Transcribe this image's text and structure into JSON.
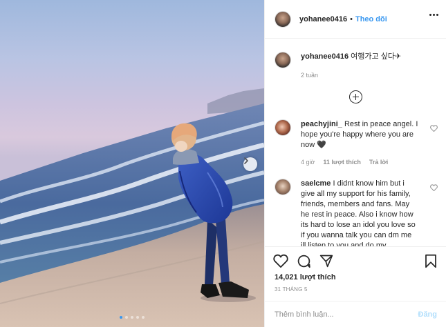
{
  "post": {
    "dots_count": 5,
    "active_dot": 0
  },
  "header": {
    "username": "yohanee0416",
    "separator": "•",
    "follow_label": "Theo dõi",
    "more_icon": "more-horizontal-icon"
  },
  "caption": {
    "username": "yohanee0416",
    "text": "여행가고 싶다✈",
    "time": "2 tuần"
  },
  "load_more_icon": "plus-circle-icon",
  "comments": [
    {
      "username": "peachyjini_",
      "text": "Rest in peace angel. I hope you're happy where you are now 🖤",
      "time": "4 giờ",
      "likes": "11 lượt thích",
      "reply": "Trả lời"
    },
    {
      "username": "saelcme",
      "text": "I didnt know him but i give all my support for his family, friends, members and fans. May he rest in peace. Also i know how its hard to lose an idol you love so if you wanna talk you can dm me ill listen to you and do my"
    }
  ],
  "actions": {
    "like_icon": "heart-icon",
    "comment_icon": "comment-icon",
    "share_icon": "send-icon",
    "save_icon": "bookmark-icon",
    "likes": "14,021 lượt thích",
    "date": "31 THÁNG 5"
  },
  "add_comment": {
    "placeholder": "Thêm bình luận...",
    "post_label": "Đăng"
  },
  "colors": {
    "link_blue": "#3897f0",
    "post_disabled": "#b2dffc",
    "text": "#262626",
    "muted": "#8e8e8e",
    "border": "#efefef"
  }
}
